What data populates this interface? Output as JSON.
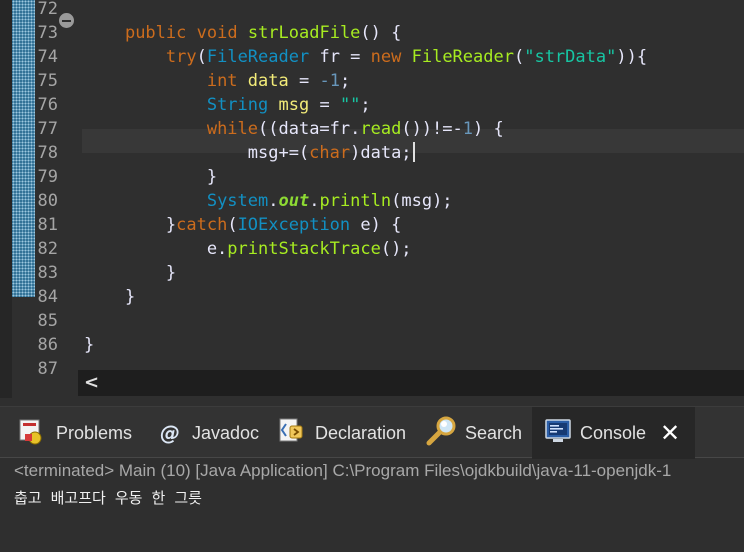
{
  "editor": {
    "line_numbers": [
      "72",
      "73",
      "74",
      "75",
      "76",
      "77",
      "78",
      "79",
      "80",
      "81",
      "82",
      "83",
      "84",
      "85",
      "86",
      "87"
    ],
    "code_lines": [
      [
        {
          "t": "",
          "c": "op"
        }
      ],
      [
        {
          "t": "    ",
          "c": "op"
        },
        {
          "t": "public",
          "c": "kw"
        },
        {
          "t": " ",
          "c": "op"
        },
        {
          "t": "void",
          "c": "kw"
        },
        {
          "t": " ",
          "c": "op"
        },
        {
          "t": "strLoadFile",
          "c": "fn"
        },
        {
          "t": "() {",
          "c": "op"
        }
      ],
      [
        {
          "t": "        ",
          "c": "op"
        },
        {
          "t": "try",
          "c": "kw"
        },
        {
          "t": "(",
          "c": "op"
        },
        {
          "t": "FileReader",
          "c": "ty"
        },
        {
          "t": " fr = ",
          "c": "op"
        },
        {
          "t": "new",
          "c": "kw"
        },
        {
          "t": " ",
          "c": "op"
        },
        {
          "t": "FileReader",
          "c": "fn"
        },
        {
          "t": "(",
          "c": "op"
        },
        {
          "t": "\"strData\"",
          "c": "st"
        },
        {
          "t": ")){",
          "c": "op"
        }
      ],
      [
        {
          "t": "            ",
          "c": "op"
        },
        {
          "t": "int",
          "c": "kw"
        },
        {
          "t": " ",
          "c": "op"
        },
        {
          "t": "data",
          "c": "va"
        },
        {
          "t": " = ",
          "c": "op"
        },
        {
          "t": "-1",
          "c": "nu"
        },
        {
          "t": ";",
          "c": "op"
        }
      ],
      [
        {
          "t": "            ",
          "c": "op"
        },
        {
          "t": "String",
          "c": "ty"
        },
        {
          "t": " ",
          "c": "op"
        },
        {
          "t": "msg",
          "c": "va"
        },
        {
          "t": " = ",
          "c": "op"
        },
        {
          "t": "\"\"",
          "c": "st"
        },
        {
          "t": ";",
          "c": "op"
        }
      ],
      [
        {
          "t": "            ",
          "c": "op"
        },
        {
          "t": "while",
          "c": "kw"
        },
        {
          "t": "((data=fr.",
          "c": "op"
        },
        {
          "t": "read",
          "c": "fn"
        },
        {
          "t": "())!=-",
          "c": "op"
        },
        {
          "t": "1",
          "c": "nu"
        },
        {
          "t": ") {",
          "c": "op"
        }
      ],
      [
        {
          "t": "                msg+=(",
          "c": "op"
        },
        {
          "t": "char",
          "c": "kw"
        },
        {
          "t": ")data;",
          "c": "op"
        }
      ],
      [
        {
          "t": "            }",
          "c": "op"
        }
      ],
      [
        {
          "t": "            ",
          "c": "op"
        },
        {
          "t": "System",
          "c": "ty"
        },
        {
          "t": ".",
          "c": "op"
        },
        {
          "t": "out",
          "c": "fd"
        },
        {
          "t": ".",
          "c": "op"
        },
        {
          "t": "println",
          "c": "fn"
        },
        {
          "t": "(msg);",
          "c": "op"
        }
      ],
      [
        {
          "t": "        }",
          "c": "op"
        },
        {
          "t": "catch",
          "c": "kw"
        },
        {
          "t": "(",
          "c": "op"
        },
        {
          "t": "IOException",
          "c": "ty"
        },
        {
          "t": " e) {",
          "c": "op"
        }
      ],
      [
        {
          "t": "            e.",
          "c": "op"
        },
        {
          "t": "printStackTrace",
          "c": "fn"
        },
        {
          "t": "();",
          "c": "op"
        }
      ],
      [
        {
          "t": "        }",
          "c": "op"
        }
      ],
      [
        {
          "t": "    }",
          "c": "op"
        }
      ],
      [
        {
          "t": "",
          "c": "op"
        }
      ],
      [
        {
          "t": "}",
          "c": "op"
        }
      ],
      [
        {
          "t": "",
          "c": "op"
        }
      ]
    ],
    "current_line": "78"
  },
  "panel": {
    "tabs": [
      {
        "label": "Problems",
        "icon": "problems-icon"
      },
      {
        "label": "Javadoc",
        "icon": "javadoc-icon"
      },
      {
        "label": "Declaration",
        "icon": "declaration-icon"
      },
      {
        "label": "Search",
        "icon": "search-icon"
      },
      {
        "label": "Console",
        "icon": "console-icon",
        "active": true
      }
    ],
    "console": {
      "status": "<terminated> Main (10) [Java Application] C:\\Program Files\\ojdkbuild\\java-11-openjdk-1",
      "output": "춥고 배고프다 우동 한 그릇"
    }
  },
  "colors": {
    "background": "#2f2f2f",
    "keyword": "#cc6c1d",
    "type": "#1290c3",
    "method": "#a7ec21",
    "string": "#17c6a3",
    "number": "#6897bb",
    "local_variable": "#f3ec79"
  }
}
